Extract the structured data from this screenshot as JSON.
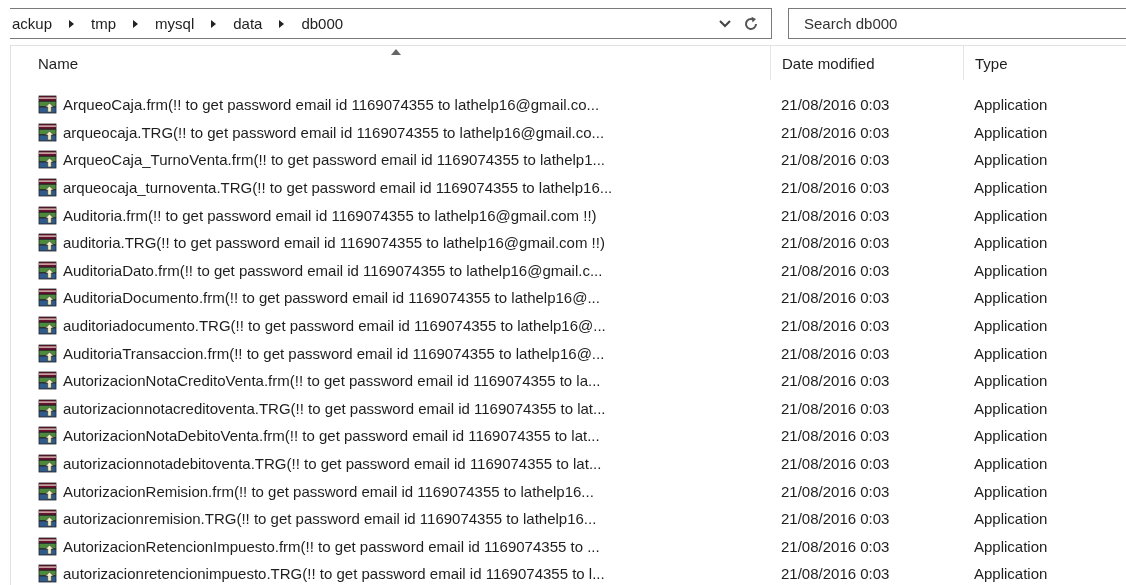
{
  "address_bar": {
    "path": [
      "ackup",
      "tmp",
      "mysql",
      "data",
      "db000"
    ]
  },
  "search": {
    "placeholder": "Search db000"
  },
  "table": {
    "columns": [
      {
        "label": "Name",
        "sorted": true
      },
      {
        "label": "Date modified",
        "sorted": false
      },
      {
        "label": "Type",
        "sorted": false
      }
    ],
    "rows": [
      {
        "name": "ArqueoCaja.frm(!! to get password email id 1169074355 to lathelp16@gmail.co...",
        "date": "21/08/2016 0:03",
        "type": "Application"
      },
      {
        "name": "arqueocaja.TRG(!! to get password email id 1169074355 to lathelp16@gmail.co...",
        "date": "21/08/2016 0:03",
        "type": "Application"
      },
      {
        "name": "ArqueoCaja_TurnoVenta.frm(!! to get password email id 1169074355 to lathelp1...",
        "date": "21/08/2016 0:03",
        "type": "Application"
      },
      {
        "name": "arqueocaja_turnoventa.TRG(!! to get password email id 1169074355 to lathelp16...",
        "date": "21/08/2016 0:03",
        "type": "Application"
      },
      {
        "name": "Auditoria.frm(!! to get password email id 1169074355 to lathelp16@gmail.com !!)",
        "date": "21/08/2016 0:03",
        "type": "Application"
      },
      {
        "name": "auditoria.TRG(!! to get password email id 1169074355 to lathelp16@gmail.com !!)",
        "date": "21/08/2016 0:03",
        "type": "Application"
      },
      {
        "name": "AuditoriaDato.frm(!! to get password email id 1169074355 to lathelp16@gmail.c...",
        "date": "21/08/2016 0:03",
        "type": "Application"
      },
      {
        "name": "AuditoriaDocumento.frm(!! to get password email id 1169074355 to lathelp16@...",
        "date": "21/08/2016 0:03",
        "type": "Application"
      },
      {
        "name": "auditoriadocumento.TRG(!! to get password email id 1169074355 to lathelp16@...",
        "date": "21/08/2016 0:03",
        "type": "Application"
      },
      {
        "name": "AuditoriaTransaccion.frm(!! to get password email id 1169074355 to lathelp16@...",
        "date": "21/08/2016 0:03",
        "type": "Application"
      },
      {
        "name": "AutorizacionNotaCreditoVenta.frm(!! to get password email id 1169074355 to la...",
        "date": "21/08/2016 0:03",
        "type": "Application"
      },
      {
        "name": "autorizacionnotacreditoventa.TRG(!! to get password email id 1169074355 to lat...",
        "date": "21/08/2016 0:03",
        "type": "Application"
      },
      {
        "name": "AutorizacionNotaDebitoVenta.frm(!! to get password email id 1169074355 to lat...",
        "date": "21/08/2016 0:03",
        "type": "Application"
      },
      {
        "name": "autorizacionnotadebitoventa.TRG(!! to get password email id 1169074355 to lat...",
        "date": "21/08/2016 0:03",
        "type": "Application"
      },
      {
        "name": "AutorizacionRemision.frm(!! to get password email id 1169074355 to lathelp16...",
        "date": "21/08/2016 0:03",
        "type": "Application"
      },
      {
        "name": "autorizacionremision.TRG(!! to get password email id 1169074355 to lathelp16...",
        "date": "21/08/2016 0:03",
        "type": "Application"
      },
      {
        "name": "AutorizacionRetencionImpuesto.frm(!! to get password email id 1169074355 to ...",
        "date": "21/08/2016 0:03",
        "type": "Application"
      },
      {
        "name": "autorizacionretencionimpuesto.TRG(!! to get password email id 1169074355 to l...",
        "date": "21/08/2016 0:03",
        "type": "Application"
      }
    ]
  }
}
